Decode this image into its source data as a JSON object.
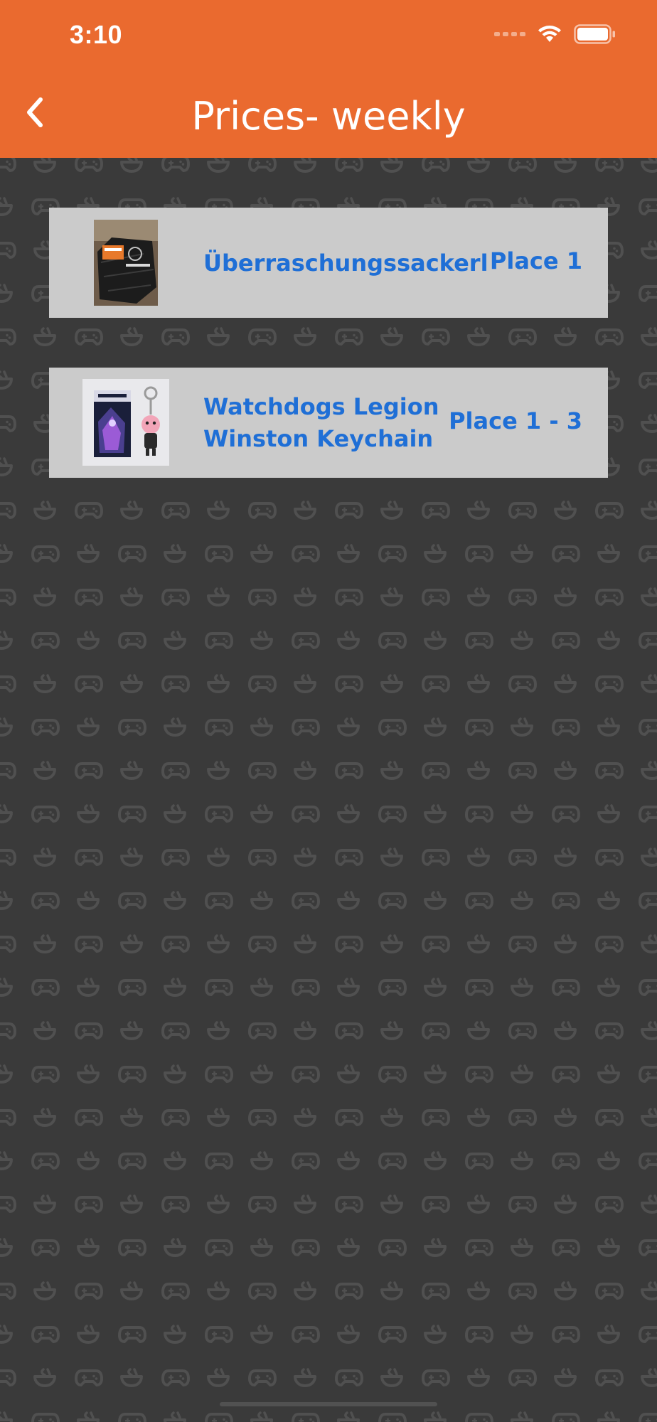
{
  "status_bar": {
    "time": "3:10"
  },
  "header": {
    "title": "Prices- weekly",
    "back_icon": "chevron-left-icon"
  },
  "prizes": [
    {
      "name": "Überraschungssackerl",
      "place": "Place 1",
      "image_icon": "gift-bag-photo"
    },
    {
      "name": "Watchdogs Legion\nWinston Keychain",
      "place": "Place 1 - 3",
      "image_icon": "keychain-photo"
    }
  ],
  "colors": {
    "header": "#ea6a2f",
    "background": "#3a3a3a",
    "card": "#cbcbcb",
    "text_accent": "#1f6fd6"
  }
}
